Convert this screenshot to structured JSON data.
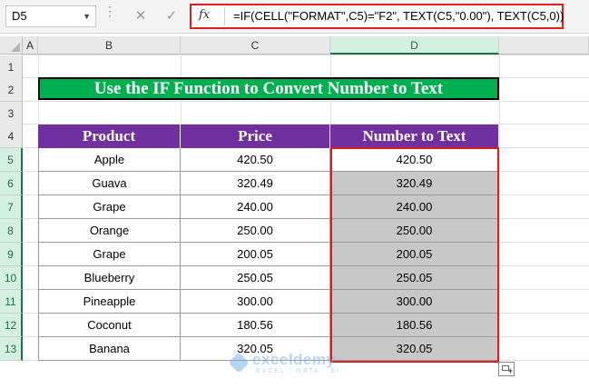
{
  "formula_bar": {
    "name_box": "D5",
    "fx_label": "fx",
    "cancel_glyph": "✕",
    "enter_glyph": "✓",
    "formula": "=IF(CELL(\"FORMAT\",C5)=\"F2\", TEXT(C5,\"0.00\"), TEXT(C5,0))"
  },
  "columns": [
    "A",
    "B",
    "C",
    "D"
  ],
  "selected_column": "D",
  "rows": [
    "1",
    "2",
    "3",
    "4",
    "5",
    "6",
    "7",
    "8",
    "9",
    "10",
    "11",
    "12",
    "13"
  ],
  "selected_rows": [
    "5",
    "6",
    "7",
    "8",
    "9",
    "10",
    "11",
    "12",
    "13"
  ],
  "title": "Use the IF Function to Convert Number to Text",
  "table": {
    "headers": [
      "Product",
      "Price",
      "Number to Text"
    ],
    "rows": [
      [
        "Apple",
        "420.50",
        "420.50"
      ],
      [
        "Guava",
        "320.49",
        "320.49"
      ],
      [
        "Grape",
        "240.00",
        "240.00"
      ],
      [
        "Orange",
        "250.00",
        "250.00"
      ],
      [
        "Grape",
        "200.05",
        "200.05"
      ],
      [
        "Blueberry",
        "250.05",
        "250.05"
      ],
      [
        "Pineapple",
        "300.00",
        "300.00"
      ],
      [
        "Coconut",
        "180.56",
        "180.56"
      ],
      [
        "Banana",
        "320.05",
        "320.05"
      ]
    ]
  },
  "watermark": {
    "name": "exceldemy",
    "tagline": "EXCEL · DATA · BI"
  },
  "colors": {
    "title_bg": "#00b050",
    "header_bg": "#7030a0",
    "selection_gray": "#c8c8c8",
    "highlight_red": "#e01c1c"
  }
}
